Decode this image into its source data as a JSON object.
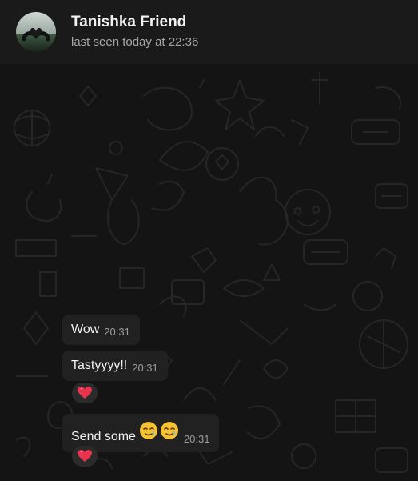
{
  "header": {
    "contact_name": "Tanishka Friend",
    "status": "last seen today at 22:36",
    "avatar_icon": "hands-heart-avatar"
  },
  "messages": [
    {
      "text": "Wow",
      "time": "20:31",
      "reaction": null
    },
    {
      "text": "Tastyyyy!!",
      "time": "20:31",
      "reaction": "heart-icon"
    },
    {
      "text": "Send some",
      "emojis": [
        "smiling-face-with-tear-icon",
        "smiling-face-with-tear-icon"
      ],
      "time": "20:31",
      "reaction": "heart-icon"
    }
  ],
  "colors": {
    "header_bg": "#1a1a1a",
    "chat_bg": "#141414",
    "bubble_bg": "#212121",
    "heart": "#e8344e"
  }
}
